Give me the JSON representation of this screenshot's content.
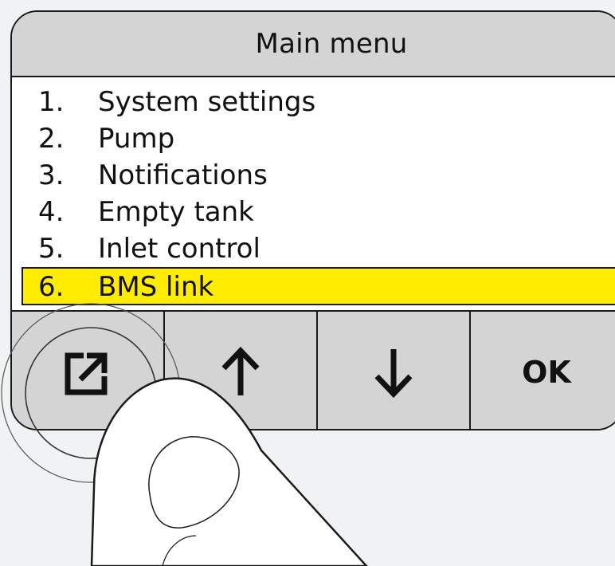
{
  "screen": {
    "title": "Main menu"
  },
  "menu": {
    "items": [
      {
        "number": "1.",
        "label": "System settings",
        "selected": false
      },
      {
        "number": "2.",
        "label": "Pump",
        "selected": false
      },
      {
        "number": "3.",
        "label": "Notifications",
        "selected": false
      },
      {
        "number": "4.",
        "label": "Empty tank",
        "selected": false
      },
      {
        "number": "5.",
        "label": "Inlet control",
        "selected": false
      },
      {
        "number": "6.",
        "label": "BMS link",
        "selected": true
      }
    ]
  },
  "soft_keys": {
    "back_icon": "exit-arrow-icon",
    "up_icon": "arrow-up-icon",
    "down_icon": "arrow-down-icon",
    "ok_label": "OK"
  },
  "colors": {
    "highlight": "#ffec00",
    "panel_gray": "#d4d4d4",
    "screen_white": "#ffffff",
    "background": "#f1f2f4"
  }
}
